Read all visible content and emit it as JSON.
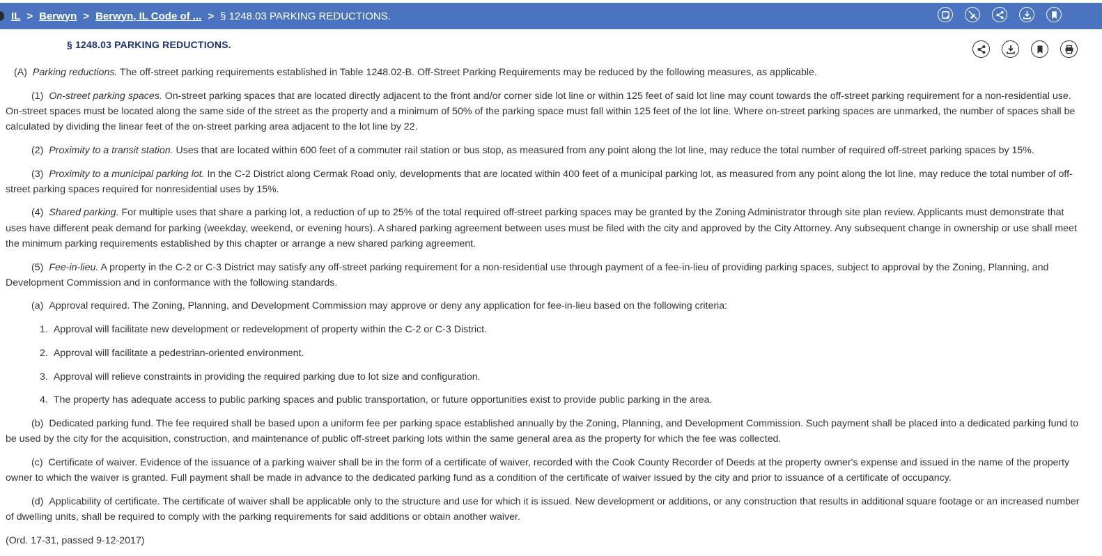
{
  "breadcrumb": {
    "items": [
      "IL",
      "Berwyn",
      "Berwyn, IL Code of ..."
    ],
    "current": "§ 1248.03 PARKING REDUCTIONS.",
    "separator": ">"
  },
  "toolbar_icons": [
    "notes-icon",
    "annotate-off-icon",
    "share-icon",
    "download-icon",
    "bookmark-icon"
  ],
  "section": {
    "title": "§ 1248.03 PARKING REDUCTIONS."
  },
  "doc_icons": [
    "share-icon",
    "download-icon",
    "bookmark-icon",
    "print-icon"
  ],
  "body": {
    "a": {
      "label": "(A)",
      "heading": "Parking reductions.",
      "text": " The off-street parking requirements established in Table 1248.02-B. Off-Street Parking Requirements may be reduced by the following measures, as applicable."
    },
    "p1": {
      "label": "(1)",
      "heading": "On-street parking spaces.",
      "text": " On-street parking spaces that are located directly adjacent to the front and/or corner side lot line or within 125 feet of said lot line may count towards the off-street parking requirement for a non-residential use. On-street spaces must be located along the same side of the street as the property and a minimum of 50% of the parking space must fall within 125 feet of the lot line. Where on-street parking spaces are unmarked, the number of spaces shall be calculated by dividing the linear feet of the on-street parking area adjacent to the lot line by 22."
    },
    "p2": {
      "label": "(2)",
      "heading": "Proximity to a transit station.",
      "text": " Uses that are located within 600 feet of a commuter rail station or bus stop, as measured from any point along the lot line, may reduce the total number of required off-street parking spaces by 15%."
    },
    "p3": {
      "label": "(3)",
      "heading": "Proximity to a municipal parking lot.",
      "text": " In the C-2 District along Cermak Road only, developments that are located within 400 feet of a municipal parking lot, as measured from any point along the lot line, may reduce the total number of off-street parking spaces required for nonresidential uses by 15%."
    },
    "p4": {
      "label": "(4)",
      "heading": "Shared parking.",
      "text": " For multiple uses that share a parking lot, a reduction of up to 25% of the total required off-street parking spaces may be granted by the Zoning Administrator through site plan review. Applicants must demonstrate that uses have different peak demand for parking (weekday, weekend, or evening hours). A shared parking agreement between uses must be filed with the city and approved by the City Attorney. Any subsequent change in ownership or use shall meet the minimum parking requirements established by this chapter or arrange a new shared parking agreement."
    },
    "p5": {
      "label": "(5)",
      "heading": "Fee-in-lieu.",
      "text": " A property in the C-2 or C-3 District may satisfy any off-street parking requirement for a non-residential use through payment of a fee-in-lieu of providing parking spaces, subject to approval by the Zoning, Planning, and Development Commission and in conformance with the following standards."
    },
    "sa": {
      "label": "(a)",
      "text": "Approval required. The Zoning, Planning, and Development Commission may approve or deny any application for fee-in-lieu based on the following criteria:"
    },
    "n1": {
      "label": "1.",
      "text": "Approval will facilitate new development or redevelopment of property within the C-2 or C-3 District."
    },
    "n2": {
      "label": "2.",
      "text": "Approval will facilitate a pedestrian-oriented environment."
    },
    "n3": {
      "label": "3.",
      "text": "Approval will relieve constraints in providing the required parking due to lot size and configuration."
    },
    "n4": {
      "label": "4.",
      "text": "The property has adequate access to public parking spaces and public transportation, or future opportunities exist to provide public parking in the area."
    },
    "sb": {
      "label": "(b)",
      "text": "Dedicated parking fund. The fee required shall be based upon a uniform fee per parking space established annually by the Zoning, Planning, and Development Commission. Such payment shall be placed into a dedicated parking fund to be used by the city for the acquisition, construction, and maintenance of public off-street parking lots within the same general area as the property for which the fee was collected."
    },
    "sc": {
      "label": "(c)",
      "text": "Certificate of waiver. Evidence of the issuance of a parking waiver shall be in the form of a certificate of waiver, recorded with the Cook County Recorder of Deeds at the property owner's expense and issued in the name of the property owner to which the waiver is granted. Full payment shall be made in advance to the dedicated parking fund as a condition of the certificate of waiver issued by the city and prior to issuance of a certificate of occupancy."
    },
    "sd": {
      "label": "(d)",
      "text": "Applicability of certificate. The certificate of waiver shall be applicable only to the structure and use for which it is issued. New development or additions, or any construction that results in additional square footage or an increased number of dwelling units, shall be required to comply with the parking requirements for said additions or obtain another waiver."
    },
    "history": "(Ord. 17-31, passed 9-12-2017)"
  }
}
